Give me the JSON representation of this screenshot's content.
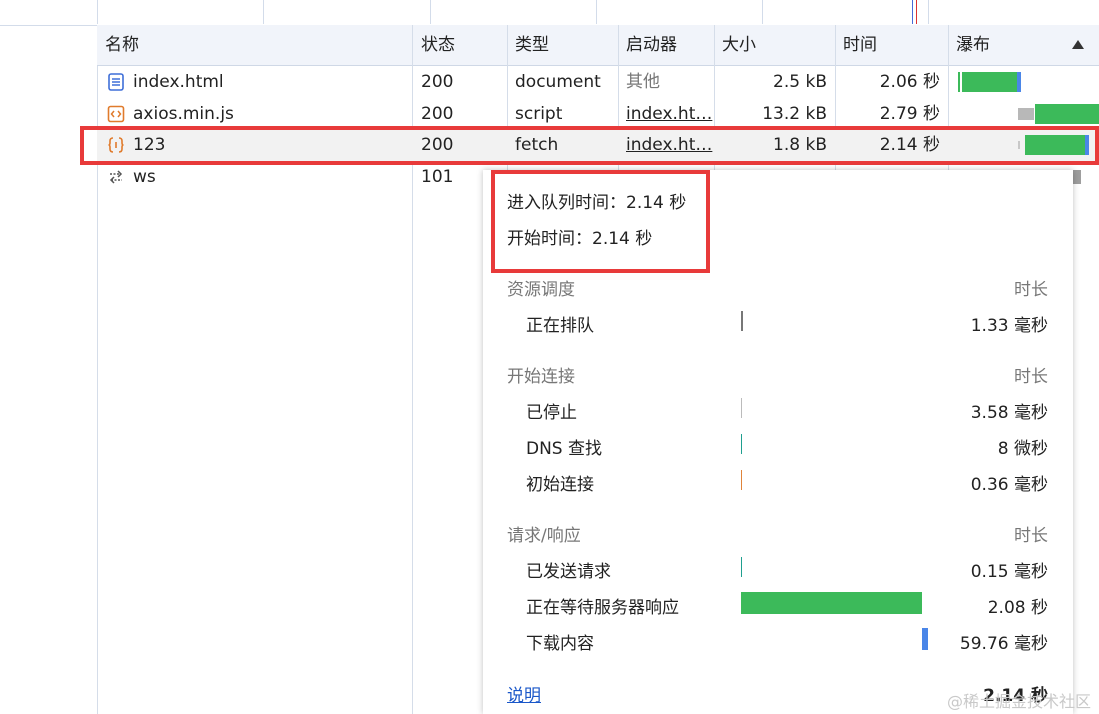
{
  "columns": {
    "name": "名称",
    "status": "状态",
    "type": "类型",
    "initiator": "启动器",
    "size": "大小",
    "time": "时间",
    "waterfall": "瀑布",
    "sort_icon": "sort-ascending-icon"
  },
  "rows": [
    {
      "icon": "document-icon",
      "name": "index.html",
      "status": "200",
      "type": "document",
      "initiator": "其他",
      "size": "2.5 kB",
      "time": "2.06 秒"
    },
    {
      "icon": "script-icon",
      "name": "axios.min.js",
      "status": "200",
      "type": "script",
      "initiator": "index.ht…",
      "size": "13.2 kB",
      "time": "2.79 秒"
    },
    {
      "icon": "fetch-icon",
      "name": "123",
      "status": "200",
      "type": "fetch",
      "initiator": "index.ht…",
      "size": "1.8 kB",
      "time": "2.14 秒"
    },
    {
      "icon": "websocket-icon",
      "name": "ws",
      "status": "101"
    }
  ],
  "tooltip": {
    "queued_at": "进入队列时间：2.14 秒",
    "started_at": "开始时间：2.14 秒",
    "sections": [
      {
        "title": "资源调度",
        "duration_label": "时长",
        "items": [
          {
            "label": "正在排队",
            "value": "1.33 毫秒"
          }
        ]
      },
      {
        "title": "开始连接",
        "duration_label": "时长",
        "items": [
          {
            "label": "已停止",
            "value": "3.58 毫秒"
          },
          {
            "label": "DNS 查找",
            "value": "8 微秒"
          },
          {
            "label": "初始连接",
            "value": "0.36 毫秒"
          }
        ]
      },
      {
        "title": "请求/响应",
        "duration_label": "时长",
        "items": [
          {
            "label": "已发送请求",
            "value": "0.15 毫秒"
          },
          {
            "label": "正在等待服务器响应",
            "value": "2.08 秒"
          },
          {
            "label": "下载内容",
            "value": "59.76 毫秒"
          }
        ]
      }
    ],
    "explanation_link": "说明",
    "total": "2.14 秒"
  },
  "watermark": "@稀土掘金技术社区",
  "colors": {
    "highlight_border": "#e83a3a",
    "waiting_bar": "#3cba5a",
    "download_bar": "#4a86e8",
    "header_bg": "#f1f4fa"
  }
}
